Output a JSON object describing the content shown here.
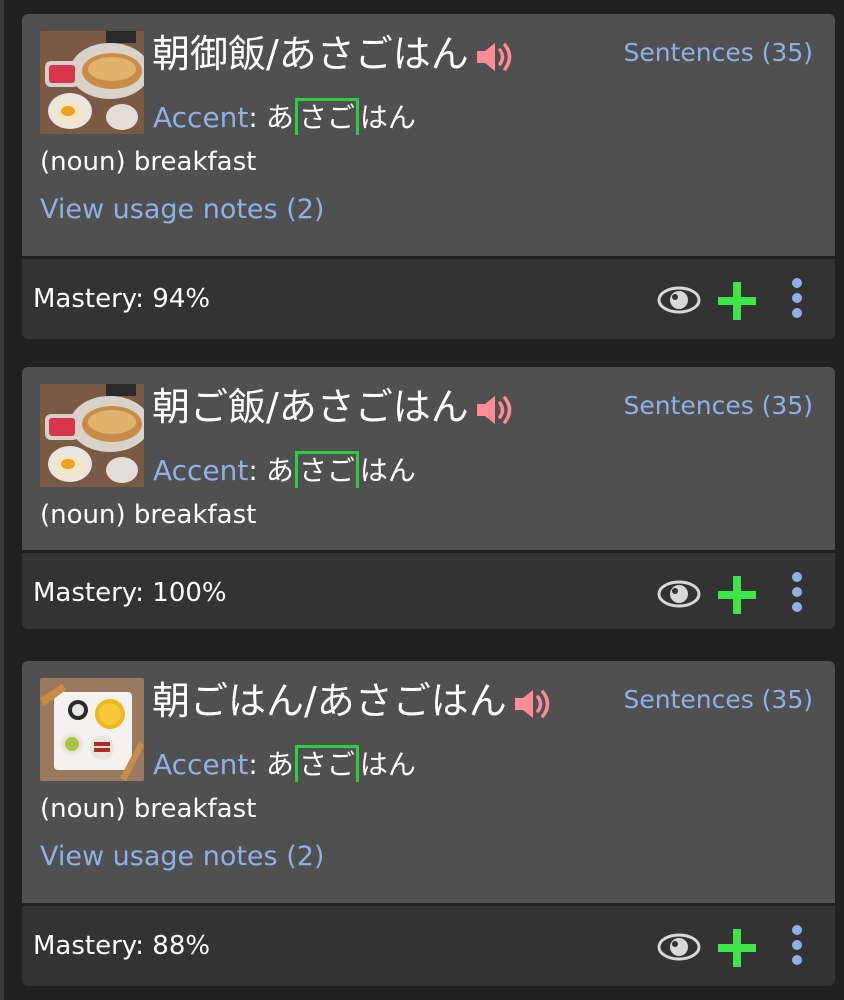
{
  "colors": {
    "background": "#202020",
    "card_top": "#505050",
    "card_bottom": "#333333",
    "link_blue": "#8fb0e6",
    "accent_green": "#2ecc40",
    "plus_green": "#3fe64a",
    "speaker_pink": "#ff8c94"
  },
  "cards": [
    {
      "word": "朝御飯/あさごはん",
      "speaker_icon": "speaker-icon",
      "sentences_label": "Sentences (35)",
      "accent_label": "Accent",
      "accent_colon": ":",
      "accent_pre": "あ",
      "accent_high": "さご",
      "accent_post": "はん",
      "definition": "(noun) breakfast",
      "usage_notes": "View usage notes (2)",
      "mastery": "Mastery: 94%"
    },
    {
      "word": "朝ご飯/あさごはん",
      "speaker_icon": "speaker-icon",
      "sentences_label": "Sentences (35)",
      "accent_label": "Accent",
      "accent_colon": ":",
      "accent_pre": "あ",
      "accent_high": "さご",
      "accent_post": "はん",
      "definition": "(noun) breakfast",
      "mastery": "Mastery: 100%"
    },
    {
      "word": "朝ごはん/あさごはん",
      "speaker_icon": "speaker-icon",
      "sentences_label": "Sentences (35)",
      "accent_label": "Accent",
      "accent_colon": ":",
      "accent_pre": "あ",
      "accent_high": "さご",
      "accent_post": "はん",
      "definition": "(noun) breakfast",
      "usage_notes": "View usage notes (2)",
      "mastery": "Mastery: 88%"
    }
  ]
}
